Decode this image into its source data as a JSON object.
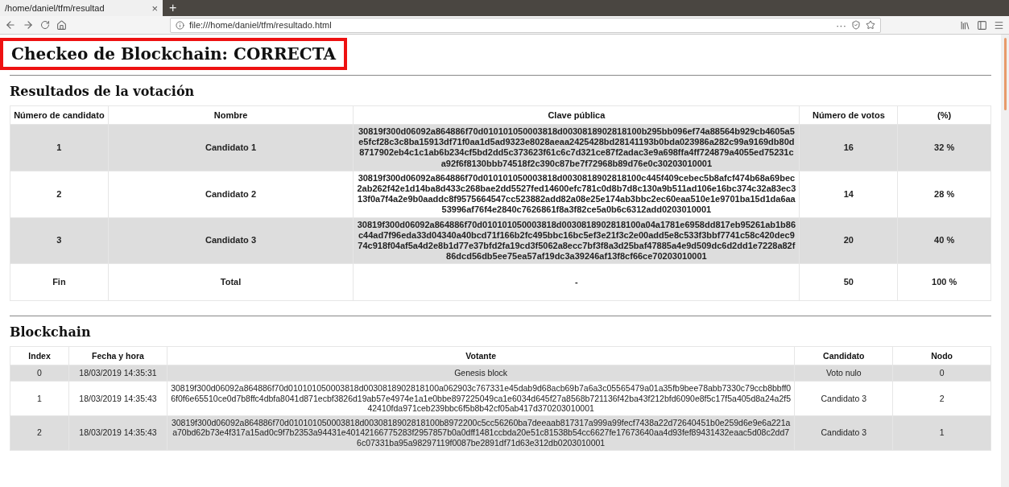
{
  "browser": {
    "tab": {
      "title": "/home/daniel/tfm/resultad",
      "close": "×"
    },
    "new_tab": "+",
    "url": "file:///home/daniel/tfm/resultado.html",
    "more": "···"
  },
  "page": {
    "title": "Checkeo de Blockchain: CORRECTA",
    "title_highlighted": true,
    "results": {
      "heading": "Resultados de la votación",
      "columns": [
        "Número de candidato",
        "Nombre",
        "Clave pública",
        "Número de votos",
        "(%)"
      ],
      "rows": [
        {
          "number": "1",
          "name": "Candidato 1",
          "key": "30819f300d06092a864886f70d010101050003818d0030818902818100b295bb096ef74a88564b929cb4605a5e5fcf28c3c8ba15913df71f0aa1d5ad9323e8028aeaa2425428bd28141193b0bda023986a282c99a9169db80d8717902eb4c1c1ab6b234cf5bd2dd5c373623f61c6c7d321ce87f2adac3e9a698ffa4ff724879a4055ed75231ca92f6f8130bbb74518f2c390c87be7f72968b89d76e0c30203010001",
          "votes": "16",
          "percent": "32 %"
        },
        {
          "number": "2",
          "name": "Candidato 2",
          "key": "30819f300d06092a864886f70d010101050003818d0030818902818100c445f409cebec5b8afcf474b68a69bec2ab262f42e1d14ba8d433c268bae2dd5527fed14600efc781c0d8b7d8c130a9b511ad106e16bc374c32a83ec313f0a7f4a2e9b0aaddc8f9575664547cc523882add82a08e25e174ab3bbc2ec60eaa510e1e9701ba15d1da6aa53996af76f4e2840c7626861f8a3f82ce5a0b6c6312add0203010001",
          "votes": "14",
          "percent": "28 %"
        },
        {
          "number": "3",
          "name": "Candidato 3",
          "key": "30819f300d06092a864886f70d010101050003818d0030818902818100a04a1781e6958dd817eb95261ab1b86c44ad7f96eda33d04340a40bcd71f166b2fc495bbc16bc5ef3e21f3c2e00add5e8c533f3bbf7741c58c420dec974c918f04af5a4d2e8b1d77e37bfd2fa19cd3f5062a8ecc7bf3f8a3d25baf47885a4e9d509dc6d2dd1e7228a82f86dcd56db5ee75ea57af19dc3a39246af13f8cf66ce70203010001",
          "votes": "20",
          "percent": "40 %"
        },
        {
          "number": "Fin",
          "name": "Total",
          "key": "-",
          "votes": "50",
          "percent": "100 %"
        }
      ]
    },
    "blockchain": {
      "heading": "Blockchain",
      "columns": [
        "Index",
        "Fecha y hora",
        "Votante",
        "Candidato",
        "Nodo"
      ],
      "rows": [
        {
          "index": "0",
          "date": "18/03/2019 14:35:31",
          "voter": "Genesis block",
          "candidate": "Voto nulo",
          "node": "0"
        },
        {
          "index": "1",
          "date": "18/03/2019 14:35:43",
          "voter": "30819f300d06092a864886f70d010101050003818d0030818902818100a062903c767331e45dab9d68acb69b7a6a3c05565479a01a35fb9bee78abb7330c79ccb8bbff06f0f6e65510ce0d7b8ffc4dbfa8041d871ecbf3826d19ab57e4974e1a1e0bbe897225049ca1e6034d645f27a8568b721136f42ba43f212bfd6090e8f5c17f5a405d8a24a2f542410fda971ceb239bbc6f5b8b42cf05ab417d370203010001",
          "candidate": "Candidato 3",
          "node": "2"
        },
        {
          "index": "2",
          "date": "18/03/2019 14:35:43",
          "voter": "30819f300d06092a864886f70d010101050003818d0030818902818100b8972200c5cc56260ba7deeaab817317a999a99fecf7438a22d72640451b0e259d6e9e6a221aa70bd62b73e4f317a15ad0c9f7b2353a94431e40142166775283f2957857b0a0dff1481ccbda20e51c81538b54cc6627fe17673640aa4d93fef89431432eaac5d08c2dd76c07331ba95a98297119f0087be2891df71d63e312db0203010001",
          "candidate": "Candidato 3",
          "node": "1"
        }
      ]
    }
  }
}
